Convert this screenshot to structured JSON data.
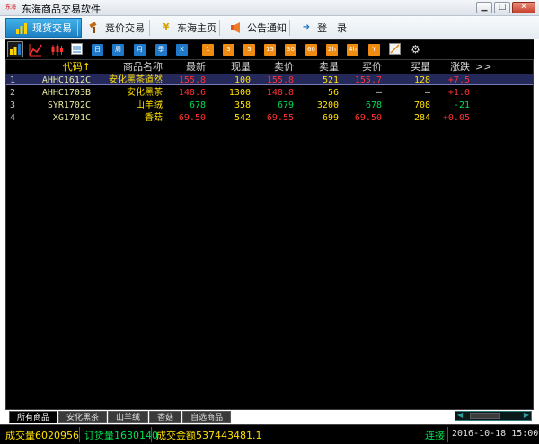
{
  "window": {
    "title": "东海商品交易软件",
    "app_icon_text": "东海",
    "controls": {
      "minimize": "▁",
      "maximize": "□",
      "close": "✕"
    }
  },
  "nav": {
    "tabs": [
      {
        "label": "现货交易",
        "icon": "chart-icon",
        "active": true
      },
      {
        "label": "竞价交易",
        "icon": "auction-icon",
        "active": false
      },
      {
        "label": "东海主页",
        "icon": "yen-icon",
        "active": false
      },
      {
        "label": "公告通知",
        "icon": "speaker-icon",
        "active": false
      },
      {
        "label": "登　录",
        "icon": "login-icon",
        "active": false
      }
    ]
  },
  "toolbar": {
    "period_buttons": [
      "日",
      "周",
      "月",
      "季",
      "X"
    ],
    "minute_buttons": [
      "1",
      "3",
      "5",
      "15",
      "30",
      "60",
      "2h",
      "4h",
      "Y"
    ]
  },
  "table": {
    "headers": {
      "index": "",
      "code": "代码↑",
      "name": "商品名称",
      "last": "最新",
      "volume": "现量",
      "ask": "卖价",
      "ask_volume": "卖量",
      "bid": "买价",
      "bid_volume": "买量",
      "change": "涨跌",
      "more": ">>"
    },
    "rows": [
      {
        "index": "1",
        "code": "AHHC1612C",
        "name": "安化黑茶道然",
        "last": "155.8",
        "volume": "100",
        "ask": "155.8",
        "ask_volume": "521",
        "bid": "155.7",
        "bid_volume": "128",
        "change": "+7.5",
        "direction": "up",
        "bid_dir": "up",
        "selected": true
      },
      {
        "index": "2",
        "code": "AHHC1703B",
        "name": "安化黑茶",
        "last": "148.6",
        "volume": "1300",
        "ask": "148.8",
        "ask_volume": "56",
        "bid": "—",
        "bid_volume": "—",
        "change": "+1.0",
        "direction": "up",
        "bid_dir": "flat",
        "selected": false
      },
      {
        "index": "3",
        "code": "SYR1702C",
        "name": "山羊绒",
        "last": "678",
        "volume": "358",
        "ask": "679",
        "ask_volume": "3200",
        "bid": "678",
        "bid_volume": "708",
        "change": "-21",
        "direction": "down",
        "bid_dir": "down",
        "selected": false
      },
      {
        "index": "4",
        "code": "XG1701C",
        "name": "香菇",
        "last": "69.50",
        "volume": "542",
        "ask": "69.55",
        "ask_volume": "699",
        "bid": "69.50",
        "bid_volume": "284",
        "change": "+0.05",
        "direction": "up",
        "bid_dir": "up",
        "selected": false
      }
    ]
  },
  "bottom_tabs": [
    {
      "label": "所有商品",
      "active": true
    },
    {
      "label": "安化黑茶",
      "active": false
    },
    {
      "label": "山羊绒",
      "active": false
    },
    {
      "label": "香菇",
      "active": false
    },
    {
      "label": "自选商品",
      "active": false
    }
  ],
  "status": {
    "volume": "成交量6020956",
    "order_volume": "订货量1630140",
    "amount": "成交金额537443481.1",
    "connection": "连接",
    "datetime": "2016-10-18 15:00"
  },
  "colors": {
    "up": "#ff3232",
    "down": "#00e050",
    "highlight": "#ffe000",
    "accent": "#1f78c8"
  }
}
